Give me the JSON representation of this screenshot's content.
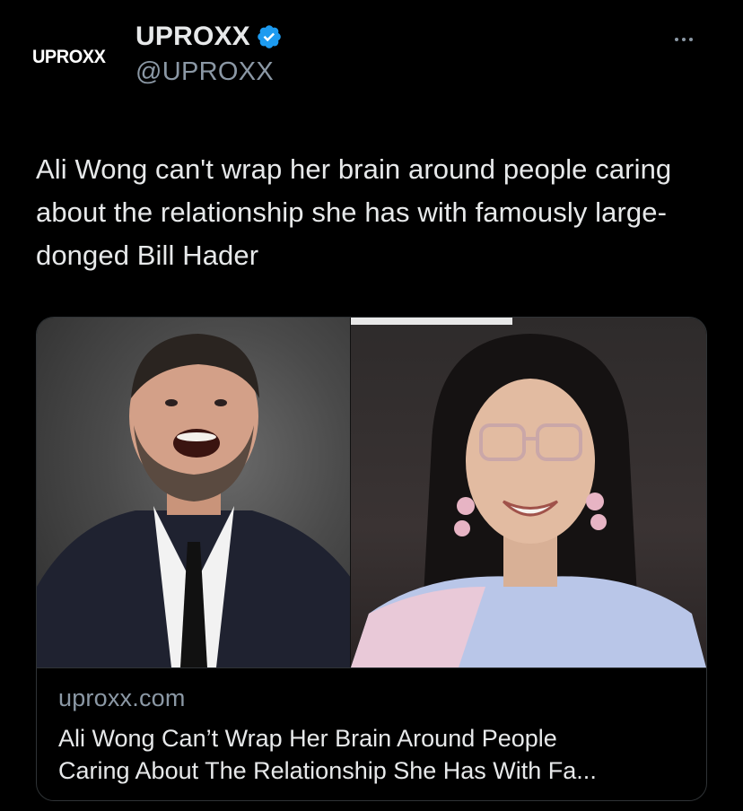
{
  "author": {
    "avatar_text": "UPROXX",
    "display_name": "UPROXX",
    "handle": "@UPROXX",
    "verified_color": "#1d9bf0"
  },
  "tweet": {
    "text": "Ali Wong can't wrap her brain around people caring about the relationship she has with famously large-donged Bill Hader"
  },
  "card": {
    "domain": "uproxx.com",
    "title": "Ali Wong Can’t Wrap Her Brain Around People\nCaring About The Relationship She Has With Fa..."
  },
  "icons": {
    "more": "more-horizontal-icon",
    "verified": "verified-badge-icon"
  },
  "colors": {
    "background": "#000000",
    "text_primary": "#e7e9ea",
    "text_secondary": "#8b98a5",
    "border": "#2f3336"
  }
}
